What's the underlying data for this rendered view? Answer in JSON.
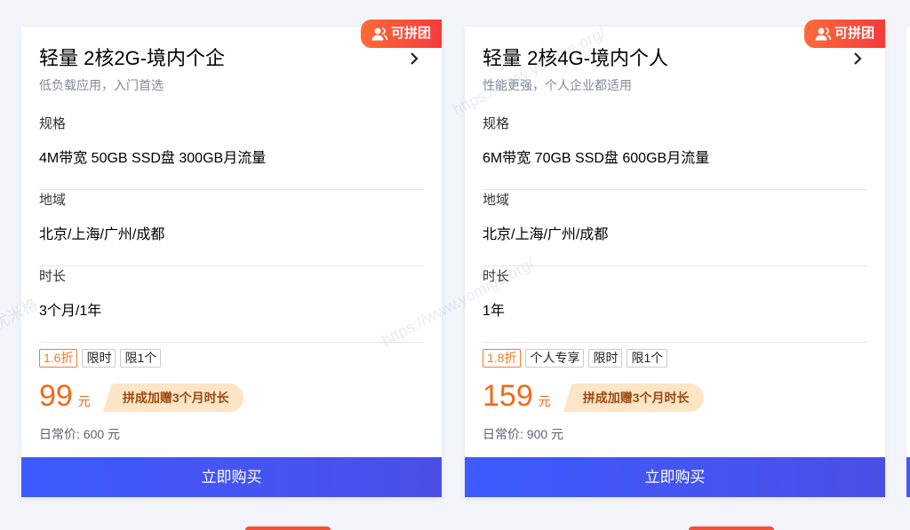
{
  "cards": [
    {
      "badge": "可拼团",
      "title": "轻量 2核2G-境内个企",
      "subtitle": "低负载应用，入门首选",
      "specs": [
        {
          "label": "规格",
          "value": "4M带宽 50GB SSD盘 300GB月流量"
        },
        {
          "label": "地域",
          "value": "北京/上海/广州/成都"
        },
        {
          "label": "时长",
          "value": "3个月/1年"
        }
      ],
      "tags": [
        "1.6折",
        "限时",
        "限1个"
      ],
      "price": "99",
      "unit": "元",
      "promo": "拼成加赠3个月时长",
      "original_price": "日常价: 600 元",
      "buy_label": "立即购买"
    },
    {
      "badge": "可拼团",
      "title": "轻量 2核4G-境内个人",
      "subtitle": "性能更强，个人企业都适用",
      "specs": [
        {
          "label": "规格",
          "value": "6M带宽 70GB SSD盘 600GB月流量"
        },
        {
          "label": "地域",
          "value": "北京/上海/广州/成都"
        },
        {
          "label": "时长",
          "value": "1年"
        }
      ],
      "tags": [
        "1.8折",
        "个人专享",
        "限时",
        "限1个"
      ],
      "price": "159",
      "unit": "元",
      "promo": "拼成加赠3个月时长",
      "original_price": "日常价: 900 元",
      "buy_label": "立即购买"
    }
  ],
  "watermark": {
    "url": "https://www.yomige.org/",
    "name": "优米格"
  },
  "colors": {
    "accent": "#3d5bff",
    "price": "#f06a1a",
    "badge": "#f53b3b"
  },
  "icons": [
    "users-icon",
    "chevron-right-icon"
  ]
}
